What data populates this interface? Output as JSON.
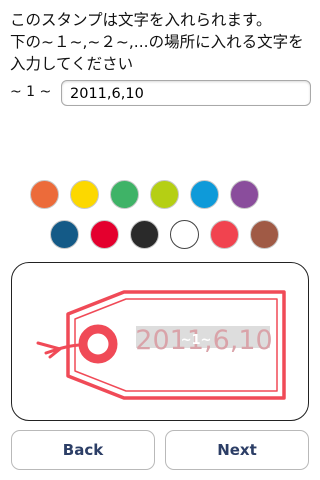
{
  "instruction": {
    "line1": "このスタンプは文字を入れられます。",
    "line2": "下の~１~,~２~,...の場所に入れる文字を",
    "line3": "入力してください"
  },
  "field": {
    "label": "~ 1 ~",
    "value": "2011,6,10"
  },
  "swatches": {
    "row1": [
      {
        "name": "orange",
        "color": "#ec6b3a"
      },
      {
        "name": "yellow",
        "color": "#fcd800"
      },
      {
        "name": "green",
        "color": "#3fb367"
      },
      {
        "name": "lime",
        "color": "#b5cf14"
      },
      {
        "name": "blue",
        "color": "#0e9ad9"
      },
      {
        "name": "purple",
        "color": "#8a4d9c"
      }
    ],
    "row2": [
      {
        "name": "navy",
        "color": "#145a87"
      },
      {
        "name": "crimson",
        "color": "#e4002e"
      },
      {
        "name": "black",
        "color": "#2a2a2a"
      },
      {
        "name": "white",
        "color": "#ffffff"
      },
      {
        "name": "coral-red",
        "color": "#f1434f"
      },
      {
        "name": "brown",
        "color": "#a05a45"
      }
    ]
  },
  "stamp": {
    "color": "#f04a57",
    "marker": "~1~",
    "text": "2011,6,10",
    "text_color": "#d9a3a9"
  },
  "buttons": {
    "back": "Back",
    "next": "Next"
  }
}
